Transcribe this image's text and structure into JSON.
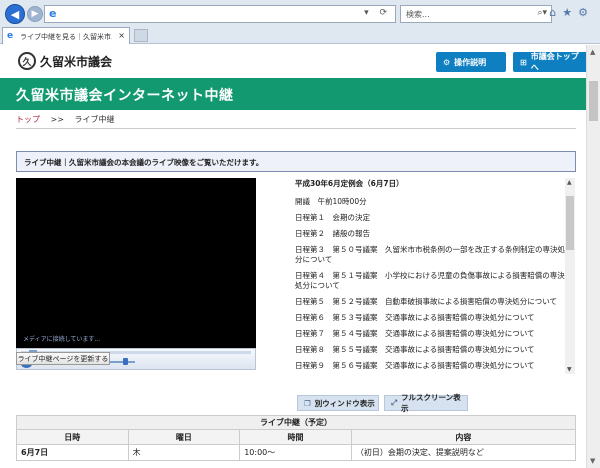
{
  "browser": {
    "address": "",
    "search_placeholder": "検索...",
    "tab_title": "ライブ中継を見る｜久留米市...",
    "tab_close": "×"
  },
  "header": {
    "logo_mark": "久",
    "site_name": "久留米市議会",
    "manual_button": "操作説明",
    "top_button": "市議会トップへ"
  },
  "title_band": "久留米市議会インターネット中継",
  "breadcrumb": {
    "home": "トップ",
    "sep": ">>",
    "current": "ライブ中継"
  },
  "info": "ライブ中継｜久留米市議会の本会議のライブ映像をご覧いただけます。",
  "player": {
    "status": "メディアに接続しています...",
    "refresh_button": "ライブ中継ページを更新する"
  },
  "agenda": {
    "title": "平成30年6月定例会（6月7日）",
    "items": [
      "開議　午前10時00分",
      "日程第１　会期の決定",
      "日程第２　諸般の報告",
      "日程第３　第５０号議案　久留米市市税条例の一部を改正する条例制定の専決処分について",
      "日程第４　第５１号議案　小学校における児童の負傷事故による損害賠償の専決処分について",
      "日程第５　第５２号議案　自動車破損事故による損害賠償の専決処分について",
      "日程第６　第５３号議案　交通事故による損害賠償の専決処分について",
      "日程第７　第５４号議案　交通事故による損害賠償の専決処分について",
      "日程第８　第５５号議案　交通事故による損害賠償の専決処分について",
      "日程第９　第５６号議案　交通事故による損害賠償の専決処分について"
    ]
  },
  "view_buttons": {
    "new_window": "別ウィンドウ表示",
    "fullscreen": "フルスクリーン表示"
  },
  "schedule": {
    "caption": "ライブ中継（予定）",
    "headers": [
      "日時",
      "曜日",
      "時間",
      "内容"
    ],
    "rows": [
      [
        "6月7日",
        "木",
        "10:00～",
        "（初日）会期の決定、提案説明など"
      ]
    ]
  }
}
